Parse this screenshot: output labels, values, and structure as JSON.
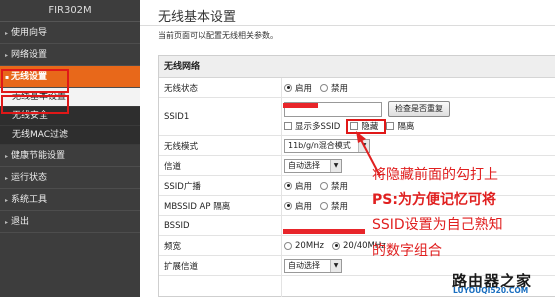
{
  "sidebar": {
    "brand": "FIR302M",
    "items": [
      {
        "label": "使用向导",
        "active": false
      },
      {
        "label": "网络设置",
        "active": false
      },
      {
        "label": "无线设置",
        "active": true
      },
      {
        "label": "健康节能设置",
        "active": false
      },
      {
        "label": "运行状态",
        "active": false
      },
      {
        "label": "系统工具",
        "active": false
      },
      {
        "label": "退出",
        "active": false
      }
    ],
    "subitems": [
      {
        "label": "无线基本设置",
        "active": true
      },
      {
        "label": "无线安全",
        "active": false
      },
      {
        "label": "无线MAC过滤",
        "active": false
      }
    ]
  },
  "main": {
    "title": "无线基本设置",
    "description": "当前页面可以配置无线相关参数。",
    "section_title": "无线网络",
    "rows": {
      "wireless_status": {
        "label": "无线状态",
        "opt_on": "启用",
        "opt_off": "禁用",
        "selected": "启用"
      },
      "ssid1": {
        "label": "SSID1",
        "check_button": "检查是否重复",
        "show_multi": "显示多SSID",
        "hide": "隐藏",
        "isolate": "隔离"
      },
      "wireless_mode": {
        "label": "无线模式",
        "value": "11b/g/n混合模式"
      },
      "channel": {
        "label": "信道",
        "value": "自动选择"
      },
      "ssid_broadcast": {
        "label": "SSID广播",
        "opt_on": "启用",
        "opt_off": "禁用",
        "selected": "启用"
      },
      "mbssid_isolation": {
        "label": "MBSSID AP 隔离",
        "opt_on": "启用",
        "opt_off": "禁用",
        "selected": "启用"
      },
      "bssid": {
        "label": "BSSID"
      },
      "bandwidth": {
        "label": "频宽",
        "opt_20": "20MHz",
        "opt_40": "20/40MHz",
        "selected": "20/40MHz"
      },
      "ext_channel": {
        "label": "扩展信道",
        "value": "自动选择"
      }
    }
  },
  "annotation": {
    "line1": "将隐藏前面的勾打上",
    "line2": "PS:为方便记忆可将",
    "line3": "SSID设置为自己熟知",
    "line4": "的数字组合",
    "color": "#e02020"
  },
  "watermark": {
    "cn": "路由器之家",
    "url": "LUYOUQI520.COM"
  },
  "colors": {
    "sidebar_bg": "#3d3d3d",
    "active_orange": "#e8681a",
    "highlight_red": "#e01818"
  }
}
